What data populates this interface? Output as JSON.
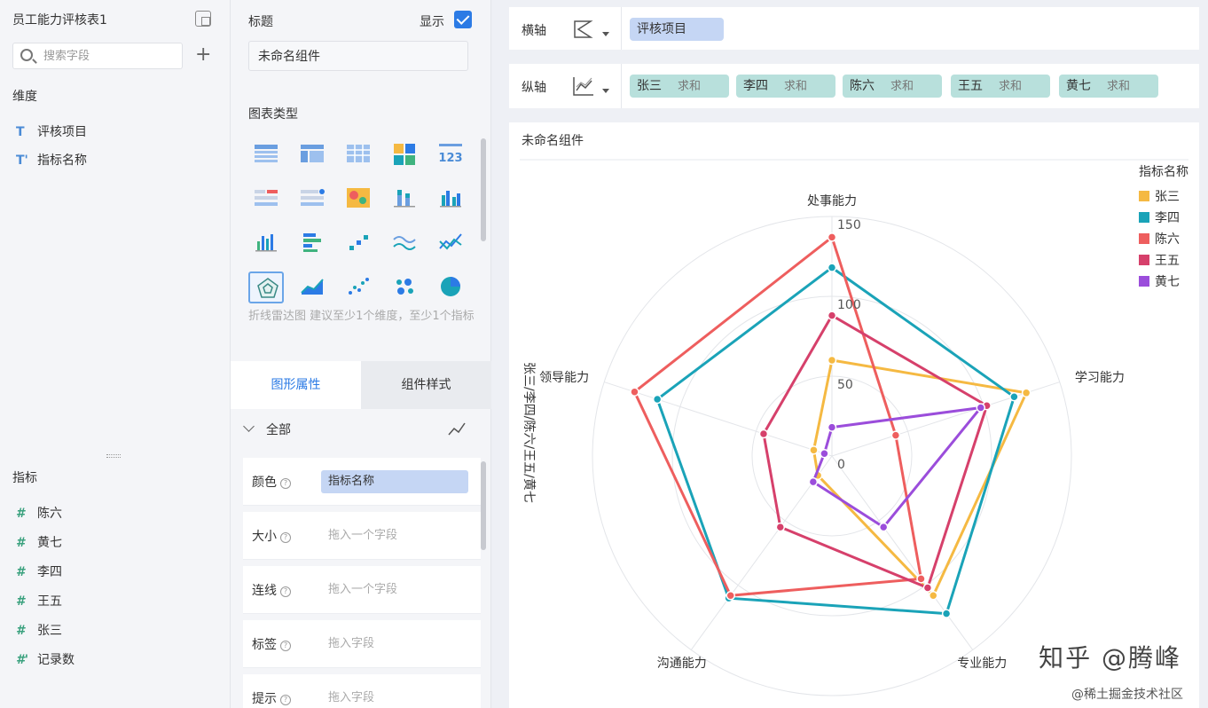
{
  "dataset": {
    "title": "员工能力评核表1",
    "search_placeholder": "搜索字段",
    "dimension_title": "维度",
    "dimensions": [
      "评核项目",
      "指标名称"
    ],
    "measure_title": "指标",
    "measures": [
      "陈六",
      "黄七",
      "李四",
      "王五",
      "张三",
      "记录数"
    ]
  },
  "config": {
    "title_label": "标题",
    "show_label": "显示",
    "title_value": "未命名组件",
    "chart_type_label": "图表类型",
    "chart_type_hint": "折线雷达图 建议至少1个维度，至少1个指标",
    "tabs": [
      "图形属性",
      "组件样式"
    ],
    "all_label": "全部",
    "props": [
      {
        "label": "颜色",
        "value": "指标名称",
        "filled": true
      },
      {
        "label": "大小",
        "value": "拖入一个字段",
        "filled": false
      },
      {
        "label": "连线",
        "value": "拖入一个字段",
        "filled": false
      },
      {
        "label": "标签",
        "value": "拖入字段",
        "filled": false
      },
      {
        "label": "提示",
        "value": "拖入字段",
        "filled": false
      }
    ]
  },
  "axes": {
    "x_label": "横轴",
    "x_field": "评核项目",
    "y_label": "纵轴",
    "y_fields": [
      {
        "name": "张三",
        "agg": "求和"
      },
      {
        "name": "李四",
        "agg": "求和"
      },
      {
        "name": "陈六",
        "agg": "求和"
      },
      {
        "name": "王五",
        "agg": "求和"
      },
      {
        "name": "黄七",
        "agg": "求和"
      }
    ]
  },
  "chart": {
    "title": "未命名组件",
    "side_label": "张三/李四/陈六/王五/黄七",
    "watermark": "知乎 @腾峰",
    "watermark2": "@稀土掘金技术社区"
  },
  "chart_data": {
    "type": "radar",
    "categories": [
      "处事能力",
      "学习能力",
      "专业能力",
      "沟通能力",
      "领导能力"
    ],
    "radial_ticks": [
      "150",
      "100",
      "50",
      "0"
    ],
    "rmax": 150,
    "legend_title": "指标名称",
    "legend_position": "right",
    "series": [
      {
        "name": "张三",
        "color": "#f5b942",
        "values": [
          60,
          128,
          108,
          15,
          12
        ]
      },
      {
        "name": "李四",
        "color": "#1aa3b8",
        "values": [
          118,
          120,
          122,
          110,
          115
        ]
      },
      {
        "name": "陈六",
        "color": "#ee5e5e",
        "values": [
          137,
          42,
          95,
          108,
          130
        ]
      },
      {
        "name": "王五",
        "color": "#d6406b",
        "values": [
          88,
          102,
          102,
          55,
          45
        ]
      },
      {
        "name": "黄七",
        "color": "#9b4ddb",
        "values": [
          18,
          98,
          55,
          20,
          5
        ]
      }
    ]
  }
}
